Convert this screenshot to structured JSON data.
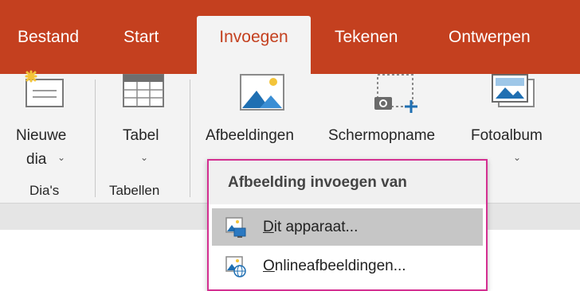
{
  "tabs": [
    "Bestand",
    "Start",
    "Invoegen",
    "Tekenen",
    "Ontwerpen"
  ],
  "ribbon": {
    "new_slide": {
      "line1": "Nieuwe",
      "line2": "dia"
    },
    "table": {
      "label": "Tabel"
    },
    "pictures": {
      "label": "Afbeeldingen"
    },
    "screenshot": {
      "label": "Schermopname"
    },
    "photoalbum": {
      "label": "Fotoalbum"
    },
    "groups": {
      "slides": "Dia's",
      "tables": "Tabellen"
    },
    "chevron": "⌄"
  },
  "dropdown": {
    "header": "Afbeelding invoegen van",
    "items": [
      {
        "hotkey": "D",
        "rest": "it apparaat...",
        "icon": "device-picture-icon"
      },
      {
        "hotkey": "O",
        "rest": "nlineafbeeldingen...",
        "icon": "online-picture-icon"
      }
    ]
  },
  "colors": {
    "accent": "#c4401f",
    "highlight": "#d42f91"
  }
}
